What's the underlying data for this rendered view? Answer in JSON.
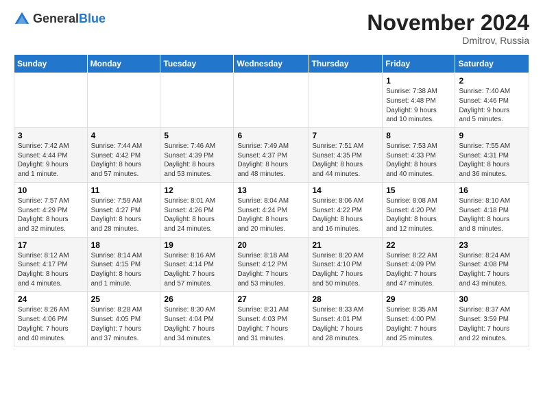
{
  "header": {
    "logo_general": "General",
    "logo_blue": "Blue",
    "month_title": "November 2024",
    "location": "Dmitrov, Russia"
  },
  "weekdays": [
    "Sunday",
    "Monday",
    "Tuesday",
    "Wednesday",
    "Thursday",
    "Friday",
    "Saturday"
  ],
  "weeks": [
    [
      {
        "day": "",
        "info": ""
      },
      {
        "day": "",
        "info": ""
      },
      {
        "day": "",
        "info": ""
      },
      {
        "day": "",
        "info": ""
      },
      {
        "day": "",
        "info": ""
      },
      {
        "day": "1",
        "info": "Sunrise: 7:38 AM\nSunset: 4:48 PM\nDaylight: 9 hours\nand 10 minutes."
      },
      {
        "day": "2",
        "info": "Sunrise: 7:40 AM\nSunset: 4:46 PM\nDaylight: 9 hours\nand 5 minutes."
      }
    ],
    [
      {
        "day": "3",
        "info": "Sunrise: 7:42 AM\nSunset: 4:44 PM\nDaylight: 9 hours\nand 1 minute."
      },
      {
        "day": "4",
        "info": "Sunrise: 7:44 AM\nSunset: 4:42 PM\nDaylight: 8 hours\nand 57 minutes."
      },
      {
        "day": "5",
        "info": "Sunrise: 7:46 AM\nSunset: 4:39 PM\nDaylight: 8 hours\nand 53 minutes."
      },
      {
        "day": "6",
        "info": "Sunrise: 7:49 AM\nSunset: 4:37 PM\nDaylight: 8 hours\nand 48 minutes."
      },
      {
        "day": "7",
        "info": "Sunrise: 7:51 AM\nSunset: 4:35 PM\nDaylight: 8 hours\nand 44 minutes."
      },
      {
        "day": "8",
        "info": "Sunrise: 7:53 AM\nSunset: 4:33 PM\nDaylight: 8 hours\nand 40 minutes."
      },
      {
        "day": "9",
        "info": "Sunrise: 7:55 AM\nSunset: 4:31 PM\nDaylight: 8 hours\nand 36 minutes."
      }
    ],
    [
      {
        "day": "10",
        "info": "Sunrise: 7:57 AM\nSunset: 4:29 PM\nDaylight: 8 hours\nand 32 minutes."
      },
      {
        "day": "11",
        "info": "Sunrise: 7:59 AM\nSunset: 4:27 PM\nDaylight: 8 hours\nand 28 minutes."
      },
      {
        "day": "12",
        "info": "Sunrise: 8:01 AM\nSunset: 4:26 PM\nDaylight: 8 hours\nand 24 minutes."
      },
      {
        "day": "13",
        "info": "Sunrise: 8:04 AM\nSunset: 4:24 PM\nDaylight: 8 hours\nand 20 minutes."
      },
      {
        "day": "14",
        "info": "Sunrise: 8:06 AM\nSunset: 4:22 PM\nDaylight: 8 hours\nand 16 minutes."
      },
      {
        "day": "15",
        "info": "Sunrise: 8:08 AM\nSunset: 4:20 PM\nDaylight: 8 hours\nand 12 minutes."
      },
      {
        "day": "16",
        "info": "Sunrise: 8:10 AM\nSunset: 4:18 PM\nDaylight: 8 hours\nand 8 minutes."
      }
    ],
    [
      {
        "day": "17",
        "info": "Sunrise: 8:12 AM\nSunset: 4:17 PM\nDaylight: 8 hours\nand 4 minutes."
      },
      {
        "day": "18",
        "info": "Sunrise: 8:14 AM\nSunset: 4:15 PM\nDaylight: 8 hours\nand 1 minute."
      },
      {
        "day": "19",
        "info": "Sunrise: 8:16 AM\nSunset: 4:14 PM\nDaylight: 7 hours\nand 57 minutes."
      },
      {
        "day": "20",
        "info": "Sunrise: 8:18 AM\nSunset: 4:12 PM\nDaylight: 7 hours\nand 53 minutes."
      },
      {
        "day": "21",
        "info": "Sunrise: 8:20 AM\nSunset: 4:10 PM\nDaylight: 7 hours\nand 50 minutes."
      },
      {
        "day": "22",
        "info": "Sunrise: 8:22 AM\nSunset: 4:09 PM\nDaylight: 7 hours\nand 47 minutes."
      },
      {
        "day": "23",
        "info": "Sunrise: 8:24 AM\nSunset: 4:08 PM\nDaylight: 7 hours\nand 43 minutes."
      }
    ],
    [
      {
        "day": "24",
        "info": "Sunrise: 8:26 AM\nSunset: 4:06 PM\nDaylight: 7 hours\nand 40 minutes."
      },
      {
        "day": "25",
        "info": "Sunrise: 8:28 AM\nSunset: 4:05 PM\nDaylight: 7 hours\nand 37 minutes."
      },
      {
        "day": "26",
        "info": "Sunrise: 8:30 AM\nSunset: 4:04 PM\nDaylight: 7 hours\nand 34 minutes."
      },
      {
        "day": "27",
        "info": "Sunrise: 8:31 AM\nSunset: 4:03 PM\nDaylight: 7 hours\nand 31 minutes."
      },
      {
        "day": "28",
        "info": "Sunrise: 8:33 AM\nSunset: 4:01 PM\nDaylight: 7 hours\nand 28 minutes."
      },
      {
        "day": "29",
        "info": "Sunrise: 8:35 AM\nSunset: 4:00 PM\nDaylight: 7 hours\nand 25 minutes."
      },
      {
        "day": "30",
        "info": "Sunrise: 8:37 AM\nSunset: 3:59 PM\nDaylight: 7 hours\nand 22 minutes."
      }
    ]
  ]
}
